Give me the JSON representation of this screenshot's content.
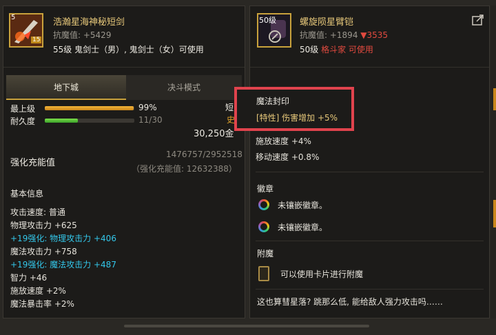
{
  "left_item": {
    "level_badge": "5",
    "badge_text": "15",
    "name": "浩瀚星海神秘短剑",
    "resist_label": "抗魔值: ",
    "resist_value": "+5429",
    "requirement": "55级 鬼剑士（男）, 鬼剑士（女）可使用"
  },
  "tabs": [
    "地下城",
    "决斗模式"
  ],
  "stats": {
    "max_level_label": "最上级",
    "max_level_pct": "99%",
    "max_level_fill": 0.99,
    "durability_label": "耐久度",
    "durability_value": "11/30",
    "durability_fill": 0.367,
    "side_type": "短",
    "side_rarity": "史",
    "price": "30,250金"
  },
  "enhance": {
    "label": "强化充能值",
    "progress": "1476757/2952518",
    "total": "（强化充能值: 12632388）"
  },
  "basic_info": {
    "title": "基本信息",
    "lines": [
      {
        "text": "攻击速度: 普通",
        "color": "#e6e3db"
      },
      {
        "text": "物理攻击力 +625",
        "color": "#e6e3db"
      },
      {
        "text": "+19强化: 物理攻击力 +406",
        "color": "#33c7ea"
      },
      {
        "text": "魔法攻击力 +758",
        "color": "#e6e3db"
      },
      {
        "text": "+19强化: 魔法攻击力 +487",
        "color": "#33c7ea"
      },
      {
        "text": "智力 +46",
        "color": "#e6e3db"
      },
      {
        "text": "施放速度 +2%",
        "color": "#e6e3db"
      },
      {
        "text": "魔法暴击率 +2%",
        "color": "#e6e3db"
      }
    ]
  },
  "right_item": {
    "level_badge": "50级",
    "name": "螺旋陨星臂铠",
    "resist_label": "抗魔值: ",
    "resist_value": "+1894",
    "resist_diff": "▼3535",
    "req_level": "50级 ",
    "req_class": "格斗家 可使用"
  },
  "right_body": {
    "magic_seal_title": "魔法封印",
    "magic_seal_line": "[特性] 伤害增加 +5%",
    "partial_line": "施放速度 +4%",
    "move_speed": "移动速度 +0.8%",
    "emblem_title": "徽章",
    "emblem_slots": [
      "未镶嵌徽章。",
      "未镶嵌徽章。"
    ],
    "enchant_title": "附魔",
    "enchant_text": "可以使用卡片进行附魔",
    "flavor": "这也算彗星落? 跳那么低, 能给敌人强力攻击吗……"
  },
  "colors": {
    "gold": "#e7c87a",
    "cyan": "#33c7ea",
    "red": "#e24a3f",
    "highlight": "#e0434d"
  }
}
